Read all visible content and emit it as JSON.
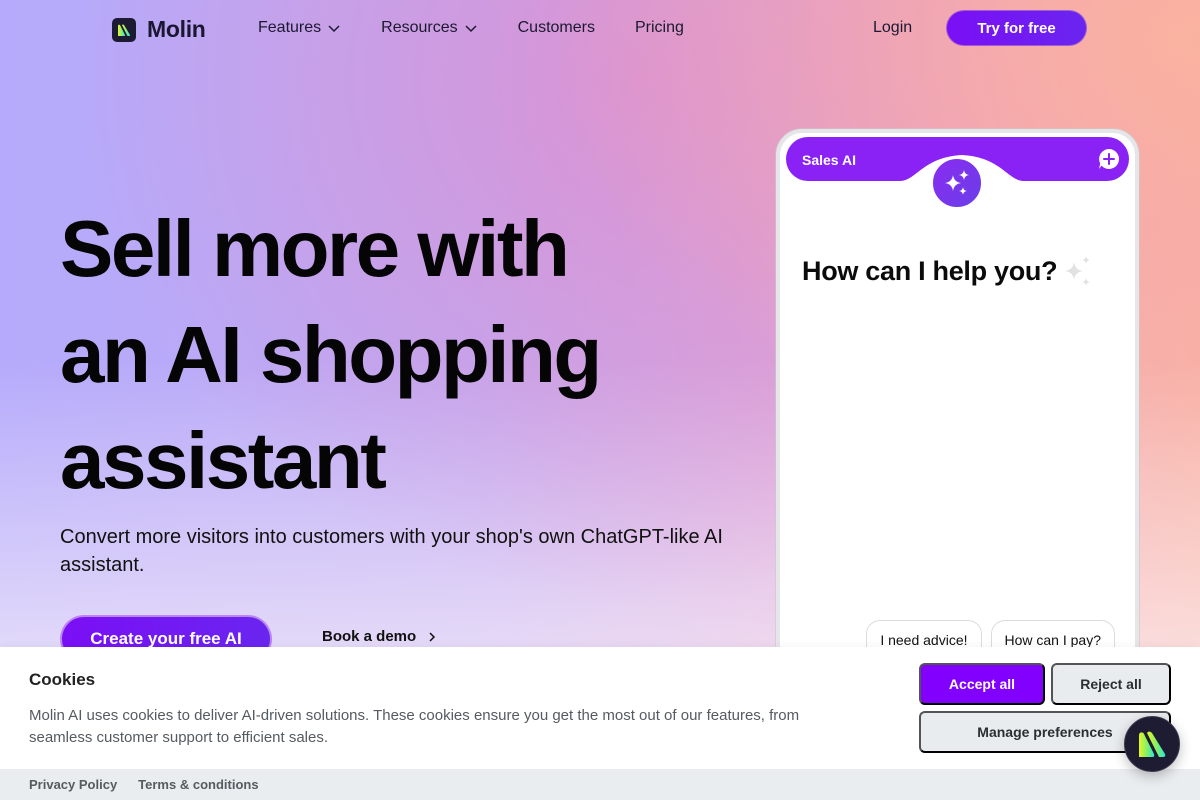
{
  "nav": {
    "brand": "Molin",
    "links": [
      {
        "label": "Features",
        "has_dropdown": true
      },
      {
        "label": "Resources",
        "has_dropdown": true
      },
      {
        "label": "Customers",
        "has_dropdown": false
      },
      {
        "label": "Pricing",
        "has_dropdown": false
      }
    ],
    "login_label": "Login",
    "try_label": "Try for free"
  },
  "hero": {
    "headline_lines": [
      "Sell more with",
      "an AI shopping",
      "assistant"
    ],
    "subheadline": "Convert more visitors into customers with your shop's own ChatGPT-like AI assistant.",
    "primary_cta": "Create your free AI",
    "secondary_cta": "Book a demo"
  },
  "widget": {
    "title": "Sales AI",
    "greeting": "How can I help you?",
    "suggestions": [
      "I need advice!",
      "How can I pay?"
    ],
    "icons": {
      "new_chat": "chat-plus-icon",
      "avatar": "sparkles-icon",
      "greeting_decoration": "sparkles-icon"
    }
  },
  "cookie_banner": {
    "title": "Cookies",
    "text": "Molin AI uses cookies to deliver AI-driven solutions. These cookies ensure you get the most out of our features, from seamless customer support to efficient sales.",
    "accept_label": "Accept all",
    "reject_label": "Reject all",
    "manage_label": "Manage preferences",
    "footer_links": [
      "Privacy Policy",
      "Terms & conditions"
    ]
  },
  "colors": {
    "accent": "#8200fe",
    "button_gradient_start": "#7a0ff5",
    "button_gradient_end": "#6a25ef",
    "widget_header": "#8a22f5",
    "secondary_button_bg": "#e9ecef",
    "launcher_bg": "#1e1c33"
  }
}
